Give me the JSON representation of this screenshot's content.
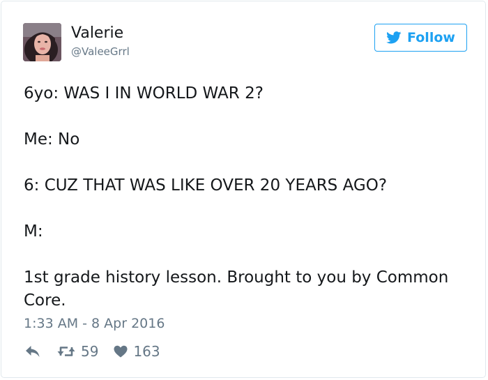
{
  "user": {
    "name": "Valerie",
    "handle": "@ValeeGrrl"
  },
  "follow_label": "Follow",
  "tweet": {
    "text": "6yo: WAS I IN WORLD WAR 2?\n\nMe: No\n\n6: CUZ THAT WAS LIKE OVER 20 YEARS AGO?\n\nM:\n\n1st grade history lesson. Brought to you by Common Core.",
    "timestamp": "1:33 AM - 8 Apr 2016"
  },
  "stats": {
    "retweets": "59",
    "likes": "163"
  },
  "icons": {
    "reply": "reply-icon",
    "retweet": "retweet-icon",
    "like": "heart-icon",
    "follow": "twitter-bird-icon"
  },
  "colors": {
    "accent": "#1da1f2",
    "secondary_text": "#657786",
    "border": "#e1e8ed"
  }
}
